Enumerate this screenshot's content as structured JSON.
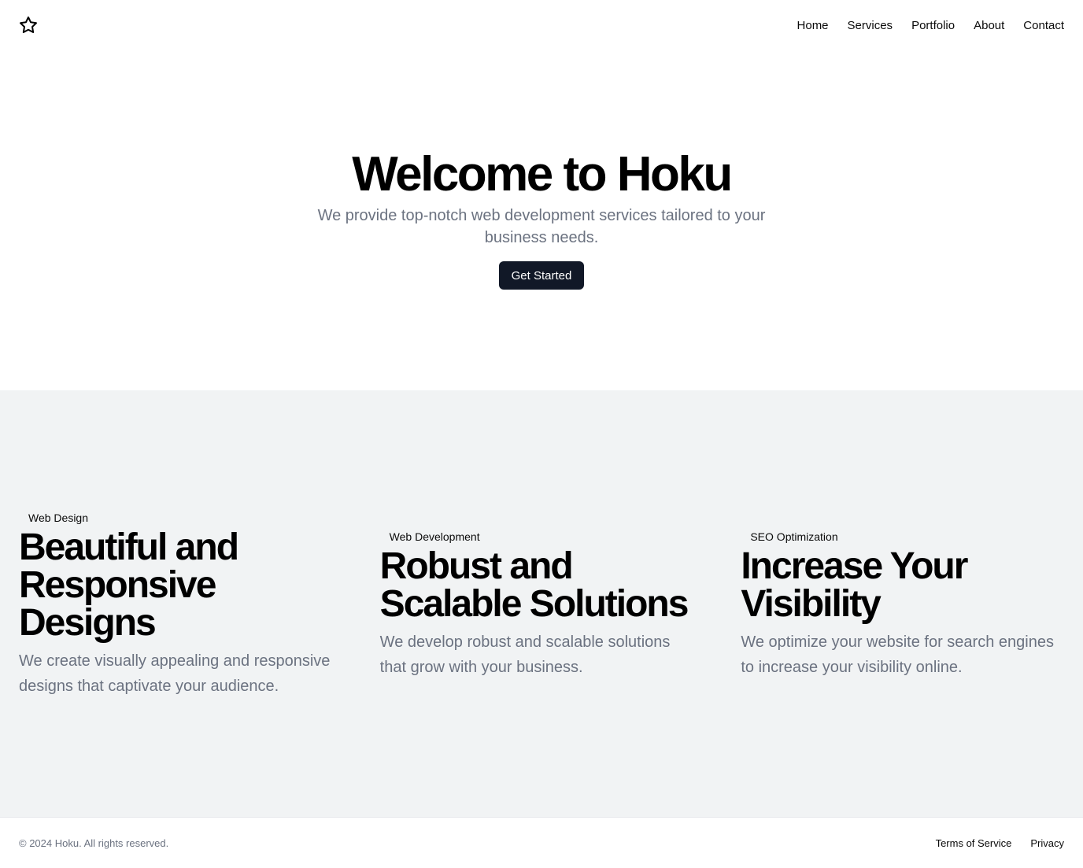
{
  "header": {
    "logo_icon": "star-icon",
    "nav": [
      {
        "label": "Home"
      },
      {
        "label": "Services"
      },
      {
        "label": "Portfolio"
      },
      {
        "label": "About"
      },
      {
        "label": "Contact"
      }
    ]
  },
  "hero": {
    "title": "Welcome to Hoku",
    "subtitle": "We provide top-notch web development services tailored to your business needs.",
    "cta_label": "Get Started"
  },
  "features": [
    {
      "tag": "Web Design",
      "title": "Beautiful and Responsive Designs",
      "description": "We create visually appealing and responsive designs that captivate your audience."
    },
    {
      "tag": "Web Development",
      "title": "Robust and Scalable Solutions",
      "description": "We develop robust and scalable solutions that grow with your business."
    },
    {
      "tag": "SEO Optimization",
      "title": "Increase Your Visibility",
      "description": "We optimize your website for search engines to increase your visibility online."
    }
  ],
  "footer": {
    "copyright": "© 2024 Hoku. All rights reserved.",
    "links": [
      {
        "label": "Terms of Service"
      },
      {
        "label": "Privacy"
      }
    ]
  },
  "colors": {
    "button_bg": "#111827",
    "muted_text": "#6b7280",
    "section_bg": "#f1f3f4"
  }
}
